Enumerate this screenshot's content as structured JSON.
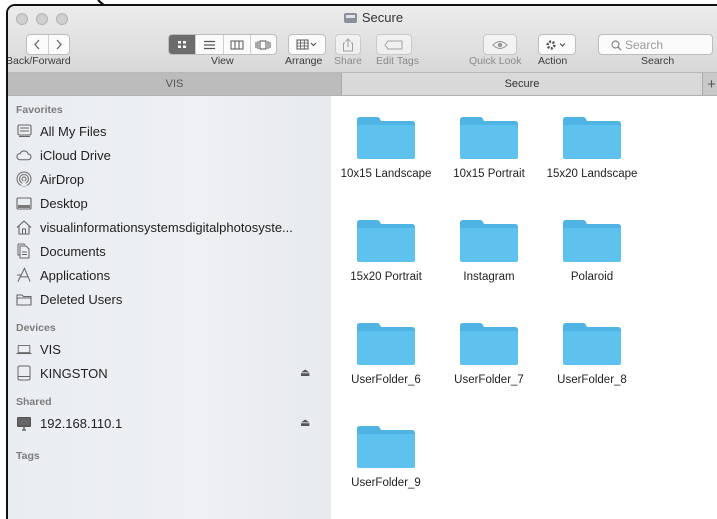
{
  "window": {
    "title": "Secure"
  },
  "toolbar": {
    "back_forward_label": "Back/Forward",
    "view_label": "View",
    "arrange_label": "Arrange",
    "share_label": "Share",
    "edit_tags_label": "Edit Tags",
    "quick_look_label": "Quick Look",
    "action_label": "Action",
    "search_label": "Search",
    "search_placeholder": "Search"
  },
  "tabs": [
    {
      "label": "VIS",
      "active": false
    },
    {
      "label": "Secure",
      "active": true
    }
  ],
  "tab_add_label": "+",
  "sidebar": {
    "favorites_header": "Favorites",
    "favorites": [
      {
        "label": "All My Files",
        "icon": "all-files-icon"
      },
      {
        "label": "iCloud Drive",
        "icon": "cloud-icon"
      },
      {
        "label": "AirDrop",
        "icon": "airdrop-icon"
      },
      {
        "label": "Desktop",
        "icon": "desktop-icon"
      },
      {
        "label": "visualinformationsystemsdigitalphotosyste...",
        "icon": "home-icon"
      },
      {
        "label": "Documents",
        "icon": "documents-icon"
      },
      {
        "label": "Applications",
        "icon": "applications-icon"
      },
      {
        "label": "Deleted Users",
        "icon": "folder-icon"
      }
    ],
    "devices_header": "Devices",
    "devices": [
      {
        "label": "VIS",
        "icon": "laptop-icon"
      },
      {
        "label": "KINGSTON",
        "icon": "drive-icon",
        "eject": "⏏"
      }
    ],
    "shared_header": "Shared",
    "shared": [
      {
        "label": "192.168.110.1",
        "icon": "monitor-icon",
        "eject": "⏏"
      }
    ],
    "tags_header": "Tags"
  },
  "folders": [
    {
      "label": "10x15 Landscape"
    },
    {
      "label": "10x15 Portrait"
    },
    {
      "label": "15x20 Landscape"
    },
    {
      "label": "15x20 Portrait"
    },
    {
      "label": "Instagram"
    },
    {
      "label": "Polaroid"
    },
    {
      "label": "UserFolder_6"
    },
    {
      "label": "UserFolder_7"
    },
    {
      "label": "UserFolder_8"
    },
    {
      "label": "UserFolder_9"
    }
  ],
  "colors": {
    "folder": "#5ec1ee",
    "folder_tab": "#4fb3e3",
    "sidebar_bg": "#eceff2"
  }
}
